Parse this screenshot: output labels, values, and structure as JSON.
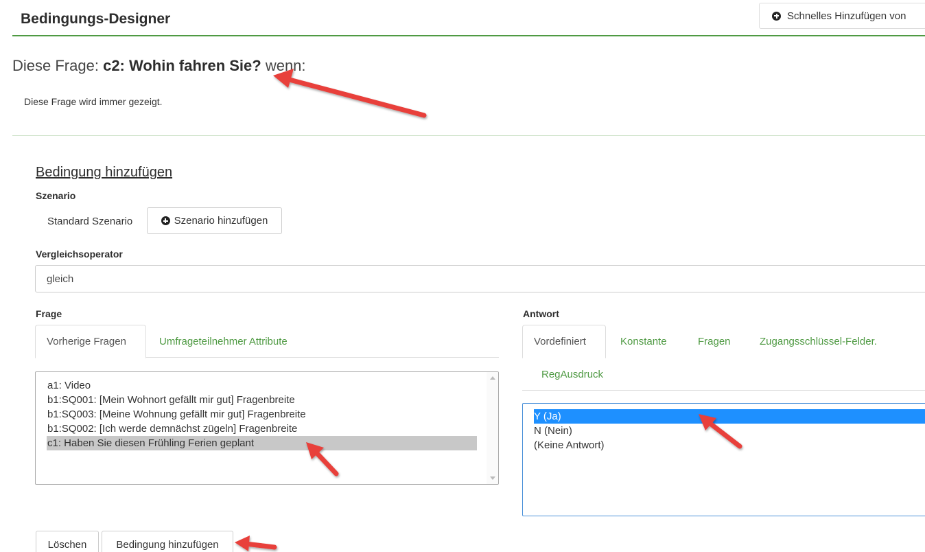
{
  "header": {
    "title": "Bedingungs-Designer",
    "quick_add_label": "Schnelles Hinzufügen von"
  },
  "question": {
    "prefix": "Diese Frage:",
    "code_text": "c2: Wohin fahren Sie?",
    "suffix": "wenn:",
    "always_shown": "Diese Frage wird immer gezeigt."
  },
  "add_condition": {
    "heading": "Bedingung hinzufügen",
    "scenario_label": "Szenario",
    "scenario_value": "Standard Szenario",
    "add_scenario_button": "Szenario hinzufügen",
    "operator_label": "Vergleichsoperator",
    "operator_value": "gleich"
  },
  "question_panel": {
    "label": "Frage",
    "tabs": [
      "Vorherige Fragen",
      "Umfrageteilnehmer Attribute"
    ],
    "active_tab": 0,
    "items": [
      "a1: Video",
      "b1:SQ001: [Mein Wohnort gefällt mir gut] Fragenbreite",
      "b1:SQ003: [Meine Wohnung gefällt mir gut] Fragenbreite",
      "b1:SQ002: [Ich werde demnächst zügeln] Fragenbreite",
      "c1: Haben Sie diesen Frühling Ferien geplant"
    ],
    "selected_index": 4
  },
  "answer_panel": {
    "label": "Antwort",
    "tabs": [
      "Vordefiniert",
      "Konstante",
      "Fragen",
      "Zugangsschlüssel-Felder.",
      "RegAusdruck"
    ],
    "active_tab": 0,
    "items": [
      "Y (Ja)",
      "N (Nein)",
      "(Keine Antwort)"
    ],
    "selected_index": 0
  },
  "footer": {
    "delete_button": "Löschen",
    "add_condition_button": "Bedingung hinzufügen"
  },
  "colors": {
    "accent_green": "#4f9a43",
    "selection_blue": "#1e90ff",
    "selection_gray": "#c8c8c8",
    "annotation_arrow": "#e8403a"
  },
  "icons": [
    "plus-circle-icon",
    "scroll-up-icon",
    "scroll-down-icon"
  ]
}
